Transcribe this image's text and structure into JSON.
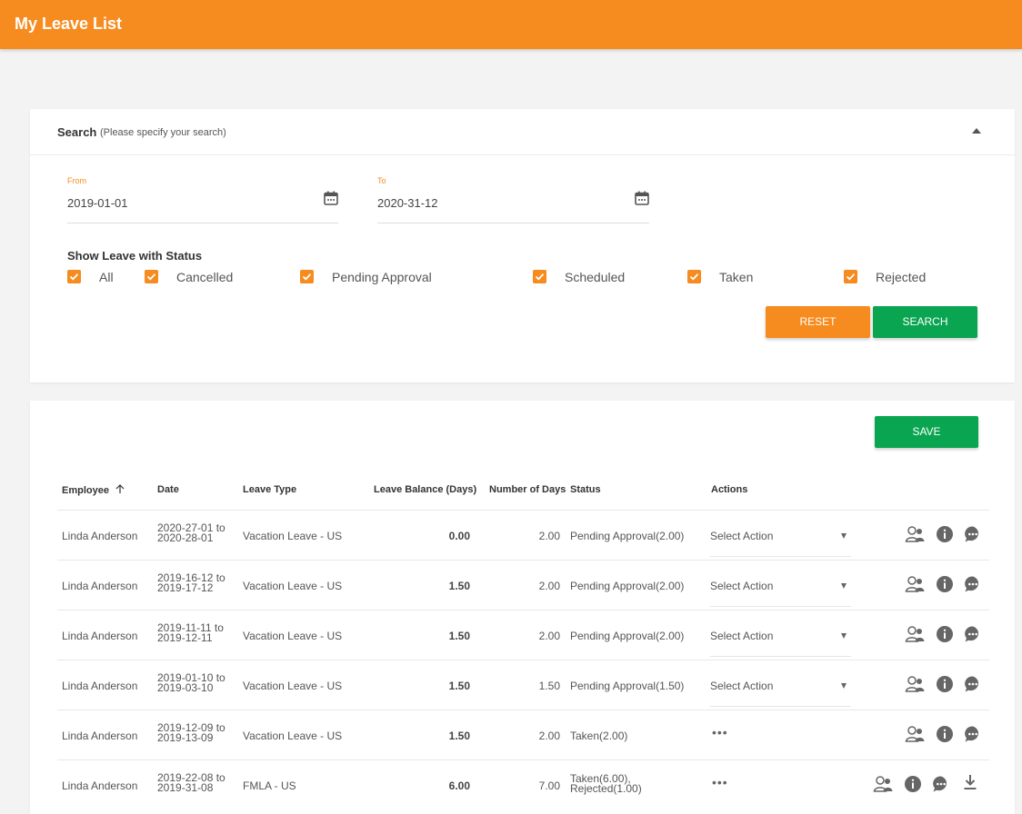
{
  "header": {
    "title": "My Leave List"
  },
  "search": {
    "title": "Search",
    "subtitle": "(Please specify your search)",
    "from_label": "From",
    "from_value": "2019-01-01",
    "to_label": "To",
    "to_value": "2020-31-12",
    "status_title": "Show Leave with Status",
    "statuses": [
      {
        "label": "All",
        "checked": true
      },
      {
        "label": "Cancelled",
        "checked": true
      },
      {
        "label": "Pending Approval",
        "checked": true
      },
      {
        "label": "Scheduled",
        "checked": true
      },
      {
        "label": "Taken",
        "checked": true
      },
      {
        "label": "Rejected",
        "checked": true
      }
    ],
    "reset_label": "RESET",
    "search_label": "SEARCH"
  },
  "list": {
    "save_label": "SAVE",
    "columns": {
      "employee": "Employee",
      "date": "Date",
      "leave_type": "Leave Type",
      "leave_balance": "Leave Balance (Days)",
      "number_of_days": "Number of Days",
      "status": "Status",
      "actions": "Actions"
    },
    "rows": [
      {
        "employee": "Linda Anderson",
        "date_line1": "2020-27-01 to",
        "date_line2": "2020-28-01",
        "leave_type": "Vacation Leave - US",
        "balance": "0.00",
        "days": "2.00",
        "status_line1": "Pending Approval(2.00)",
        "status_line2": "",
        "action": "Select Action"
      },
      {
        "employee": "Linda Anderson",
        "date_line1": "2019-16-12 to",
        "date_line2": "2019-17-12",
        "leave_type": "Vacation Leave - US",
        "balance": "1.50",
        "days": "2.00",
        "status_line1": "Pending Approval(2.00)",
        "status_line2": "",
        "action": "Select Action"
      },
      {
        "employee": "Linda Anderson",
        "date_line1": "2019-11-11 to",
        "date_line2": "2019-12-11",
        "leave_type": "Vacation Leave - US",
        "balance": "1.50",
        "days": "2.00",
        "status_line1": "Pending Approval(2.00)",
        "status_line2": "",
        "action": "Select Action"
      },
      {
        "employee": "Linda Anderson",
        "date_line1": "2019-01-10 to",
        "date_line2": "2019-03-10",
        "leave_type": "Vacation Leave - US",
        "balance": "1.50",
        "days": "1.50",
        "status_line1": "Pending Approval(1.50)",
        "status_line2": "",
        "action": "Select Action"
      },
      {
        "employee": "Linda Anderson",
        "date_line1": "2019-12-09 to",
        "date_line2": "2019-13-09",
        "leave_type": "Vacation Leave - US",
        "balance": "1.50",
        "days": "2.00",
        "status_line1": "Taken(2.00)",
        "status_line2": "",
        "action": "..."
      },
      {
        "employee": "Linda Anderson",
        "date_line1": "2019-22-08 to",
        "date_line2": "2019-31-08",
        "leave_type": "FMLA - US",
        "balance": "6.00",
        "days": "7.00",
        "status_line1": "Taken(6.00),",
        "status_line2": "Rejected(1.00)",
        "action": "..."
      }
    ]
  },
  "colors": {
    "accent": "#f68b1f",
    "success": "#0aa551"
  }
}
